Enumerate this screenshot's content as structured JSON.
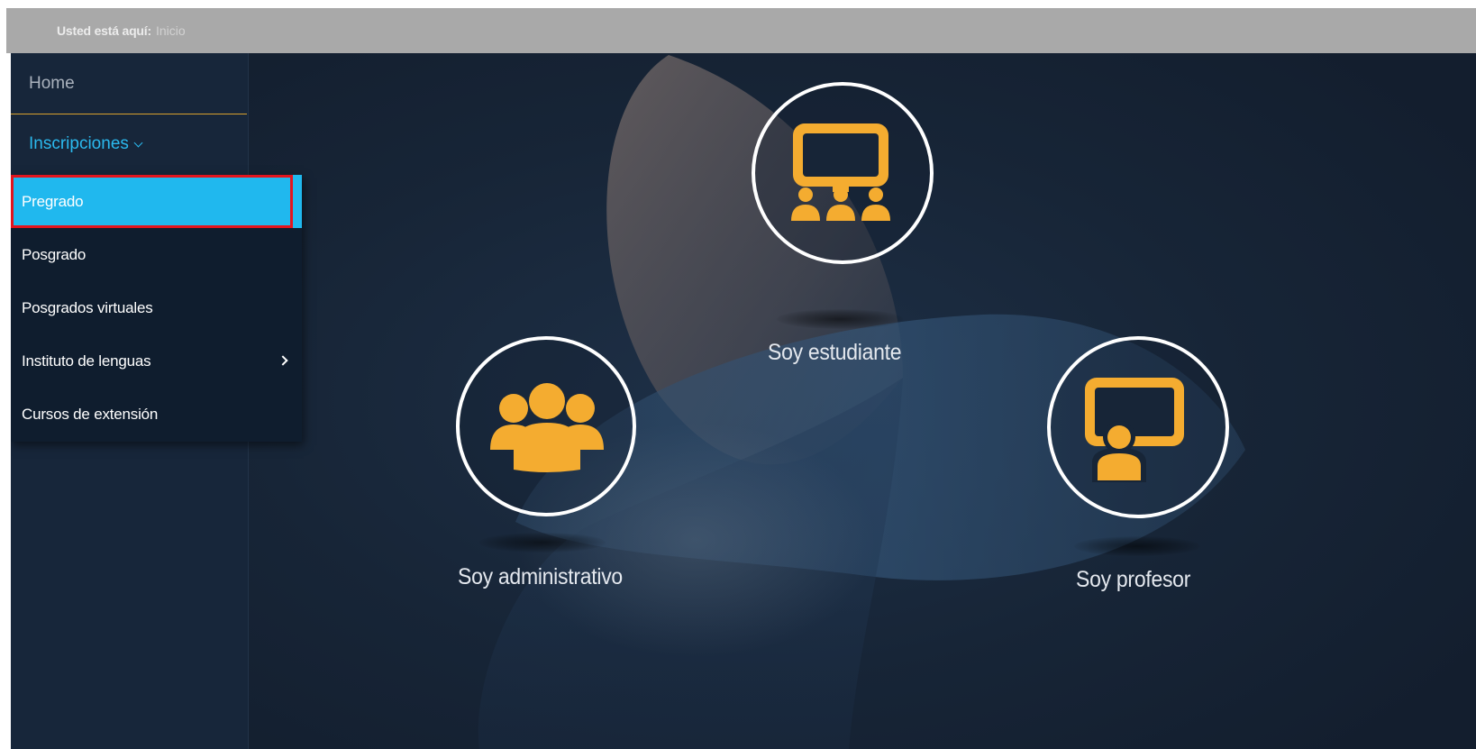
{
  "breadcrumb": {
    "prefix": "Usted está aquí:",
    "current": "Inicio"
  },
  "sidebar": {
    "home_label": "Home",
    "section_label": "Inscripciones",
    "submenu": [
      {
        "label": "Pregrado",
        "active": true
      },
      {
        "label": "Posgrado"
      },
      {
        "label": "Posgrados virtuales"
      },
      {
        "label": "Instituto de lenguas",
        "has_submenu": true
      },
      {
        "label": "Cursos de extensión"
      }
    ]
  },
  "roles": [
    {
      "label": "Soy estudiante",
      "icon": "classroom-icon"
    },
    {
      "label": "Soy administrativo",
      "icon": "group-icon"
    },
    {
      "label": "Soy profesor",
      "icon": "teacher-board-icon"
    }
  ],
  "colors": {
    "accent_blue": "#20b8ee",
    "icon_orange": "#f4ac30",
    "highlight_red": "#e3141d",
    "home_underline": "#d9a22e",
    "background": "#172537"
  }
}
